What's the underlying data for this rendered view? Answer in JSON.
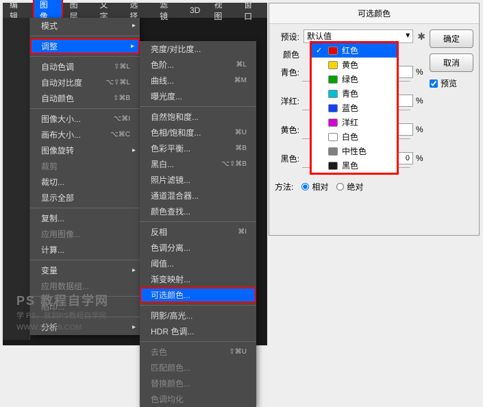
{
  "menubar": {
    "items": [
      "编辑",
      "图像",
      "图层",
      "文字",
      "选择",
      "滤镜",
      "3D",
      "视图",
      "窗口"
    ],
    "selected": 1
  },
  "menu1": {
    "groups": [
      [
        {
          "label": "模式",
          "arrow": true
        }
      ],
      [
        {
          "label": "调整",
          "arrow": true,
          "selected": true
        }
      ],
      [
        {
          "label": "自动色调",
          "shortcut": "⇧⌘L"
        },
        {
          "label": "自动对比度",
          "shortcut": "⌥⇧⌘L"
        },
        {
          "label": "自动颜色",
          "shortcut": "⇧⌘B"
        }
      ],
      [
        {
          "label": "图像大小...",
          "shortcut": "⌥⌘I"
        },
        {
          "label": "画布大小...",
          "shortcut": "⌥⌘C"
        },
        {
          "label": "图像旋转",
          "arrow": true
        },
        {
          "label": "裁剪",
          "disabled": true
        },
        {
          "label": "裁切..."
        },
        {
          "label": "显示全部"
        }
      ],
      [
        {
          "label": "复制..."
        },
        {
          "label": "应用图像...",
          "disabled": true
        },
        {
          "label": "计算..."
        }
      ],
      [
        {
          "label": "变量",
          "arrow": true
        },
        {
          "label": "应用数据组...",
          "disabled": true
        }
      ],
      [
        {
          "label": "陷印...",
          "disabled": true
        }
      ],
      [
        {
          "label": "分析",
          "arrow": true
        }
      ]
    ]
  },
  "menu2": {
    "groups": [
      [
        {
          "label": "亮度/对比度..."
        },
        {
          "label": "色阶...",
          "shortcut": "⌘L"
        },
        {
          "label": "曲线...",
          "shortcut": "⌘M"
        },
        {
          "label": "曝光度..."
        }
      ],
      [
        {
          "label": "自然饱和度..."
        },
        {
          "label": "色相/饱和度...",
          "shortcut": "⌘U"
        },
        {
          "label": "色彩平衡...",
          "shortcut": "⌘B"
        },
        {
          "label": "黑白...",
          "shortcut": "⌥⇧⌘B"
        },
        {
          "label": "照片滤镜..."
        },
        {
          "label": "通道混合器..."
        },
        {
          "label": "颜色查找..."
        }
      ],
      [
        {
          "label": "反相",
          "shortcut": "⌘I"
        },
        {
          "label": "色调分离..."
        },
        {
          "label": "阈值..."
        },
        {
          "label": "渐变映射..."
        },
        {
          "label": "可选颜色...",
          "selected": true
        }
      ],
      [
        {
          "label": "阴影/高光..."
        },
        {
          "label": "HDR 色调..."
        }
      ],
      [
        {
          "label": "去色",
          "shortcut": "⇧⌘U",
          "disabled": true
        },
        {
          "label": "匹配颜色...",
          "disabled": true
        },
        {
          "label": "替换颜色...",
          "disabled": true
        },
        {
          "label": "色调均化",
          "disabled": true
        }
      ]
    ]
  },
  "watermark": {
    "line1": "PS 教程自学网",
    "line2": "学 PS，就到PS教程自学网",
    "line3": "WWW.16XX8.COM"
  },
  "dialog": {
    "title": "可选颜色",
    "preset_label": "预设:",
    "preset_value": "默认值",
    "color_label": "颜色",
    "sliders": [
      {
        "label": "青色:",
        "value": "",
        "pct": "%"
      },
      {
        "label": "洋红:",
        "value": "",
        "pct": "%"
      },
      {
        "label": "黄色:",
        "value": "",
        "pct": "%"
      },
      {
        "label": "黑色:",
        "value": "0",
        "pct": "%"
      }
    ],
    "method_label": "方法:",
    "method_rel": "相对",
    "method_abs": "绝对",
    "ok": "确定",
    "cancel": "取消",
    "preview": "预览"
  },
  "dropdown": {
    "items": [
      {
        "label": "红色",
        "color": "#e60000",
        "selected": true
      },
      {
        "label": "黄色",
        "color": "#f5d400"
      },
      {
        "label": "绿色",
        "color": "#00a000"
      },
      {
        "label": "青色",
        "color": "#00bcd4"
      },
      {
        "label": "蓝色",
        "color": "#1040ff"
      },
      {
        "label": "洋红",
        "color": "#d400d4"
      },
      {
        "label": "白色",
        "color": "#ffffff"
      },
      {
        "label": "中性色",
        "color": "#808080"
      },
      {
        "label": "黑色",
        "color": "#1a1a1a"
      }
    ]
  }
}
